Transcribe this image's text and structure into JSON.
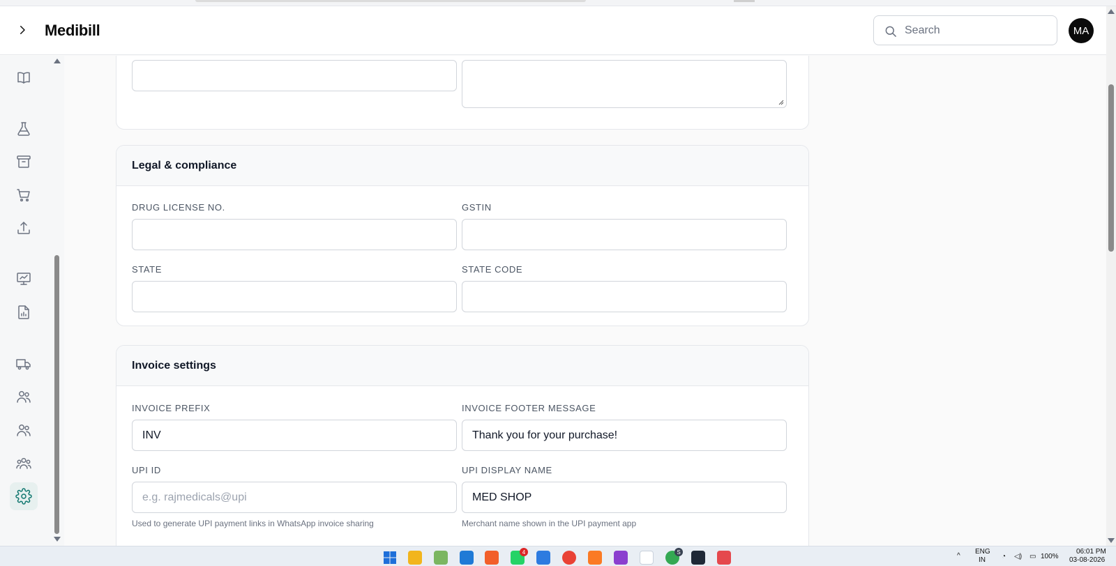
{
  "app": {
    "title": "Medibill",
    "avatar_initials": "MA"
  },
  "search": {
    "placeholder": "Search"
  },
  "sidebar": {
    "items": [
      {
        "icon": "book-icon"
      },
      {
        "icon": "flask-icon"
      },
      {
        "icon": "archive-icon"
      },
      {
        "icon": "cart-icon"
      },
      {
        "icon": "upload-icon"
      },
      {
        "icon": "presentation-chart-icon"
      },
      {
        "icon": "report-icon"
      },
      {
        "icon": "truck-icon"
      },
      {
        "icon": "users-icon"
      },
      {
        "icon": "user-group-icon"
      },
      {
        "icon": "team-icon"
      },
      {
        "icon": "settings-icon",
        "active": true
      }
    ],
    "active_color": "#0f766e"
  },
  "sections": {
    "legal": {
      "title": "Legal & compliance",
      "drug_license": {
        "label": "DRUG LICENSE NO.",
        "value": ""
      },
      "gstin": {
        "label": "GSTIN",
        "value": ""
      },
      "state": {
        "label": "STATE",
        "value": ""
      },
      "state_code": {
        "label": "STATE CODE",
        "value": ""
      }
    },
    "invoice": {
      "title": "Invoice settings",
      "prefix": {
        "label": "INVOICE PREFIX",
        "value": "INV"
      },
      "footer": {
        "label": "INVOICE FOOTER MESSAGE",
        "value": "Thank you for your purchase!"
      },
      "upi_id": {
        "label": "UPI ID",
        "value": "",
        "placeholder": "e.g. rajmedicals@upi",
        "hint": "Used to generate UPI payment links in WhatsApp invoice sharing"
      },
      "upi_name": {
        "label": "UPI DISPLAY NAME",
        "value": "MED SHOP",
        "hint": "Merchant name shown in the UPI payment app"
      }
    }
  },
  "taskbar": {
    "apps": [
      "windows-start-icon",
      "file-explorer-icon",
      "notepad-icon",
      "vscode-icon",
      "brave-icon",
      "whatsapp-icon",
      "notes-icon",
      "chrome-icon",
      "xampp-icon",
      "stack-app-icon",
      "arch-icon",
      "chrome-profile-icon",
      "terminal-icon",
      "snipping-tool-icon"
    ],
    "whatsapp_badge": "4",
    "chrome_badge": "S",
    "language": "ENG",
    "region": "IN",
    "battery": "100%",
    "time": "06:01 PM",
    "date": "03-08-2026"
  }
}
